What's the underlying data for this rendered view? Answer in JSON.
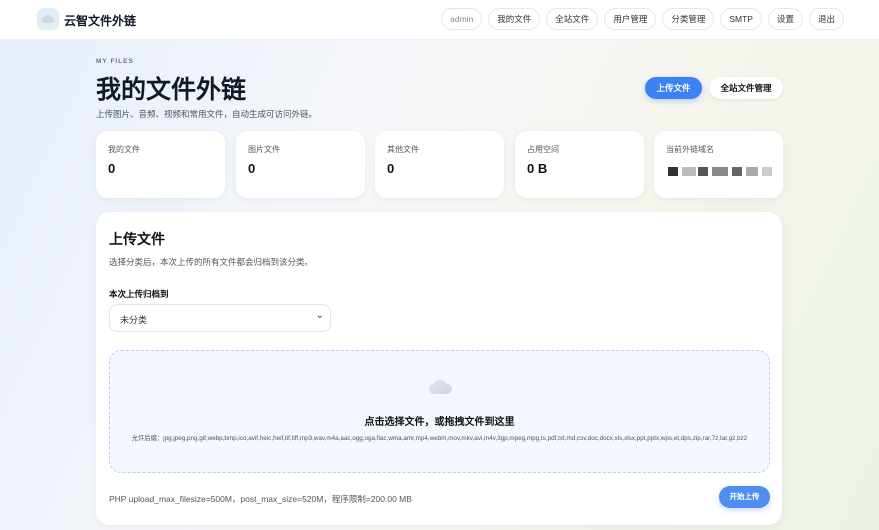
{
  "nav": {
    "brand": "云智文件外链",
    "links": [
      "admin",
      "我的文件",
      "全站文件",
      "用户管理",
      "分类管理",
      "SMTP",
      "设置",
      "退出"
    ]
  },
  "header": {
    "eyebrow": "MY FILES",
    "title": "我的文件外链",
    "subtitle": "上传图片、音频、视频和常用文件，自动生成可访问外链。",
    "upload_button": "上传文件",
    "manage_button": "全站文件管理"
  },
  "stats": [
    {
      "label": "我的文件",
      "value": "0"
    },
    {
      "label": "图片文件",
      "value": "0"
    },
    {
      "label": "其他文件",
      "value": "0"
    },
    {
      "label": "占用空间",
      "value": "0 B"
    },
    {
      "label": "当前外链域名",
      "value": ""
    }
  ],
  "upload": {
    "title": "上传文件",
    "description": "选择分类后，本次上传的所有文件都会归档到该分类。",
    "category_label": "本次上传归档到",
    "category_selected": "未分类",
    "drop_title": "点击选择文件，或拖拽文件到这里",
    "extensions": "允许后缀：jpg,jpeg,png,gif,webp,bmp,ico,avif,heic,heif,tif,tiff,mp3,wav,m4a,aac,ogg,oga,flac,wma,amr,mp4,webm,mov,mkv,avi,m4v,3gp,mpeg,mpg,ts,pdf,txt,md,csv,doc,docx,xls,xlsx,ppt,pptx,wps,et,dps,zip,rar,7z,tar,gz,bz2",
    "limits": "PHP upload_max_filesize=500M，post_max_size=520M，程序限制=200.00 MB",
    "start_button": "开始上传"
  },
  "colors": {
    "accent": "#3b82f6",
    "background": "#f6f7fa"
  },
  "icons": {
    "logo": "cloud-icon",
    "drop": "cloud-icon",
    "select": "chevron-down-icon"
  }
}
